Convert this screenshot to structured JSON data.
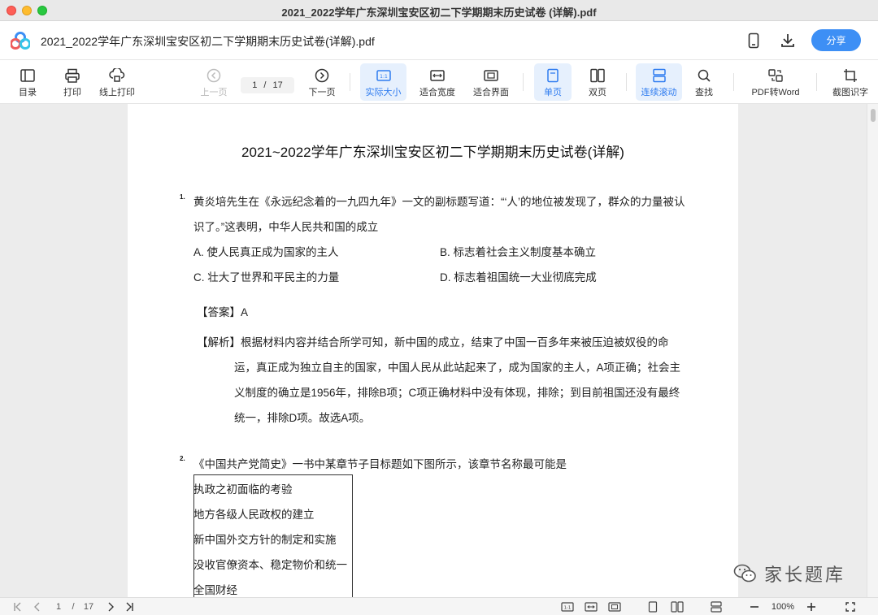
{
  "window": {
    "title": "2021_2022学年广东深圳宝安区初二下学期期末历史试卷 (详解).pdf"
  },
  "docbar": {
    "file_name": "2021_2022学年广东深圳宝安区初二下学期期末历史试卷(详解).pdf",
    "share_label": "分享",
    "icons": [
      "app-logo-icon",
      "phone-icon",
      "download-icon"
    ]
  },
  "toolbar": {
    "toc": "目录",
    "print": "打印",
    "online_print": "线上打印",
    "prev_page": "上一页",
    "current_page": "1",
    "page_sep": "/",
    "total_pages": "17",
    "next_page": "下一页",
    "actual_size": "实际大小",
    "fit_width": "适合宽度",
    "fit_page": "适合界面",
    "single_page": "单页",
    "double_page": "双页",
    "continuous": "连续滚动",
    "search": "查找",
    "pdf_to_word": "PDF转Word",
    "ocr": "截图识字",
    "active_color": "#2f7cf0",
    "active_bg": "#e6f0fd"
  },
  "document": {
    "title": "2021~2022学年广东深圳宝安区初二下学期期末历史试卷(详解)",
    "q1": {
      "num": "1.",
      "stem_line1": "黄炎培先生在《永远纪念着的一九四九年》一文的副标题写道：“‘人’的地位被发现了，群众的力量被认",
      "stem_line2": "识了。”这表明，中华人民共和国的成立",
      "opt_a": "A. 使人民真正成为国家的主人",
      "opt_b": "B. 标志着社会主义制度基本确立",
      "opt_c": "C. 壮大了世界和平民主的力量",
      "opt_d": "D. 标志着祖国统一大业彻底完成",
      "answer_label": "【答案】",
      "answer": "A",
      "analysis_label": "【解析】",
      "analysis_line1": "根据材料内容并结合所学可知，新中国的成立，结束了中国一百多年来被压迫被奴役的命",
      "analysis_line2": "运，真正成为独立自主的国家，中国人民从此站起来了，成为国家的主人，A项正确；社会主",
      "analysis_line3": "义制度的确立是1956年，排除B项；C项正确材料中没有体现，排除；到目前祖国还没有最终",
      "analysis_line4": "统一，排除D项。故选A项。"
    },
    "q2": {
      "num": "2.",
      "stem": "《中国共产党简史》一书中某章节子目标题如下图所示，该章节名称最可能是",
      "table_rows": [
        "执政之初面临的考验",
        "地方各级人民政权的建立",
        "新中国外交方针的制定和实施",
        "没收官僚资本、稳定物价和统一",
        "全国财经"
      ]
    }
  },
  "watermark": {
    "text": "家长题库",
    "icon": "wechat-icon"
  },
  "statusbar": {
    "current_page": "1",
    "page_sep": "/",
    "total_pages": "17",
    "zoom": "100%",
    "icons": [
      "first-page-icon",
      "prev-icon",
      "next-icon",
      "last-page-icon",
      "actual-size-icon",
      "fit-width-icon",
      "fit-page-icon",
      "single-page-icon",
      "double-page-icon",
      "continuous-icon",
      "zoom-out-icon",
      "zoom-in-icon",
      "fullscreen-icon"
    ]
  }
}
